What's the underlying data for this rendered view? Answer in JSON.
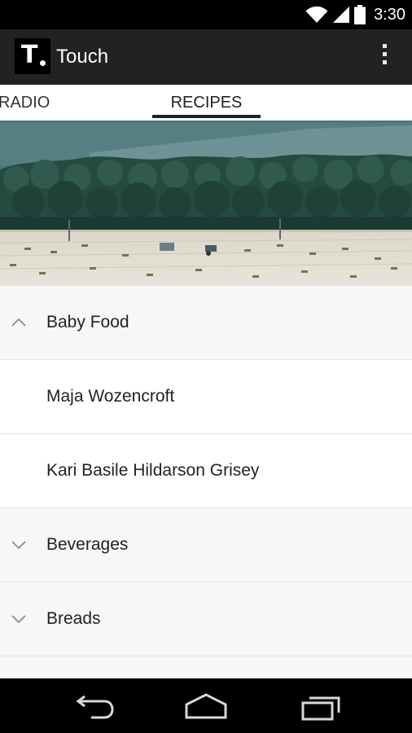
{
  "status_bar": {
    "time": "3:30",
    "icons": [
      "wifi-icon",
      "cell-signal-icon",
      "battery-icon"
    ]
  },
  "app_bar": {
    "logo_letter": "T",
    "title": "Touch",
    "overflow_icon": "more-vert-icon"
  },
  "tabs": [
    {
      "label": "RADIO",
      "selected": false
    },
    {
      "label": "RECIPES",
      "selected": true
    }
  ],
  "hero": {
    "description_icon": "landscape-photo"
  },
  "list": {
    "rows": [
      {
        "type": "group",
        "label": "Baby Food",
        "expanded": true,
        "icon": "chevron-up-icon"
      },
      {
        "type": "child",
        "label": "Maja Wozencroft"
      },
      {
        "type": "child",
        "label": "Kari Basile Hildarson Grisey"
      },
      {
        "type": "group",
        "label": "Beverages",
        "expanded": false,
        "icon": "chevron-down-icon"
      },
      {
        "type": "group",
        "label": "Breads",
        "expanded": false,
        "icon": "chevron-down-icon"
      },
      {
        "type": "group",
        "label": "",
        "expanded": false,
        "icon": ""
      }
    ]
  },
  "nav_bar": {
    "buttons": [
      "back-icon",
      "home-icon",
      "recents-icon"
    ]
  },
  "colors": {
    "app_bar": "#222222",
    "tab_indicator": "#222222",
    "group_row": "#f7f7f7",
    "child_row": "#ffffff"
  }
}
